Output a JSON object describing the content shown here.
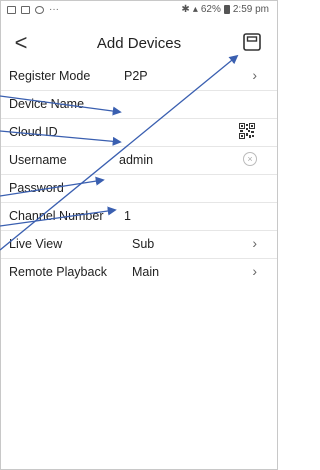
{
  "status": {
    "left_dots": "···",
    "right_text": "62%",
    "time": "2:59 pm"
  },
  "header": {
    "back_glyph": "<",
    "title": "Add Devices"
  },
  "rows": {
    "register_mode": {
      "label": "Register Mode",
      "value": "P2P"
    },
    "device_name": {
      "label": "Device Name",
      "value": ""
    },
    "cloud_id": {
      "label": "Cloud ID",
      "value": ""
    },
    "username": {
      "label": "Username",
      "value": "admin"
    },
    "password": {
      "label": "Password",
      "value": ""
    },
    "channel_number": {
      "label": "Channel Number",
      "value": "1"
    },
    "live_view": {
      "label": "Live View",
      "value": "Sub"
    },
    "remote_playback": {
      "label": "Remote Playback",
      "value": "Main"
    }
  },
  "colors": {
    "arrow": "#3a5fb0",
    "divider": "#e6e6e6"
  },
  "icons": [
    "save-icon",
    "back-icon",
    "qr-scan-icon",
    "clear-icon",
    "chevron-right-icon"
  ]
}
